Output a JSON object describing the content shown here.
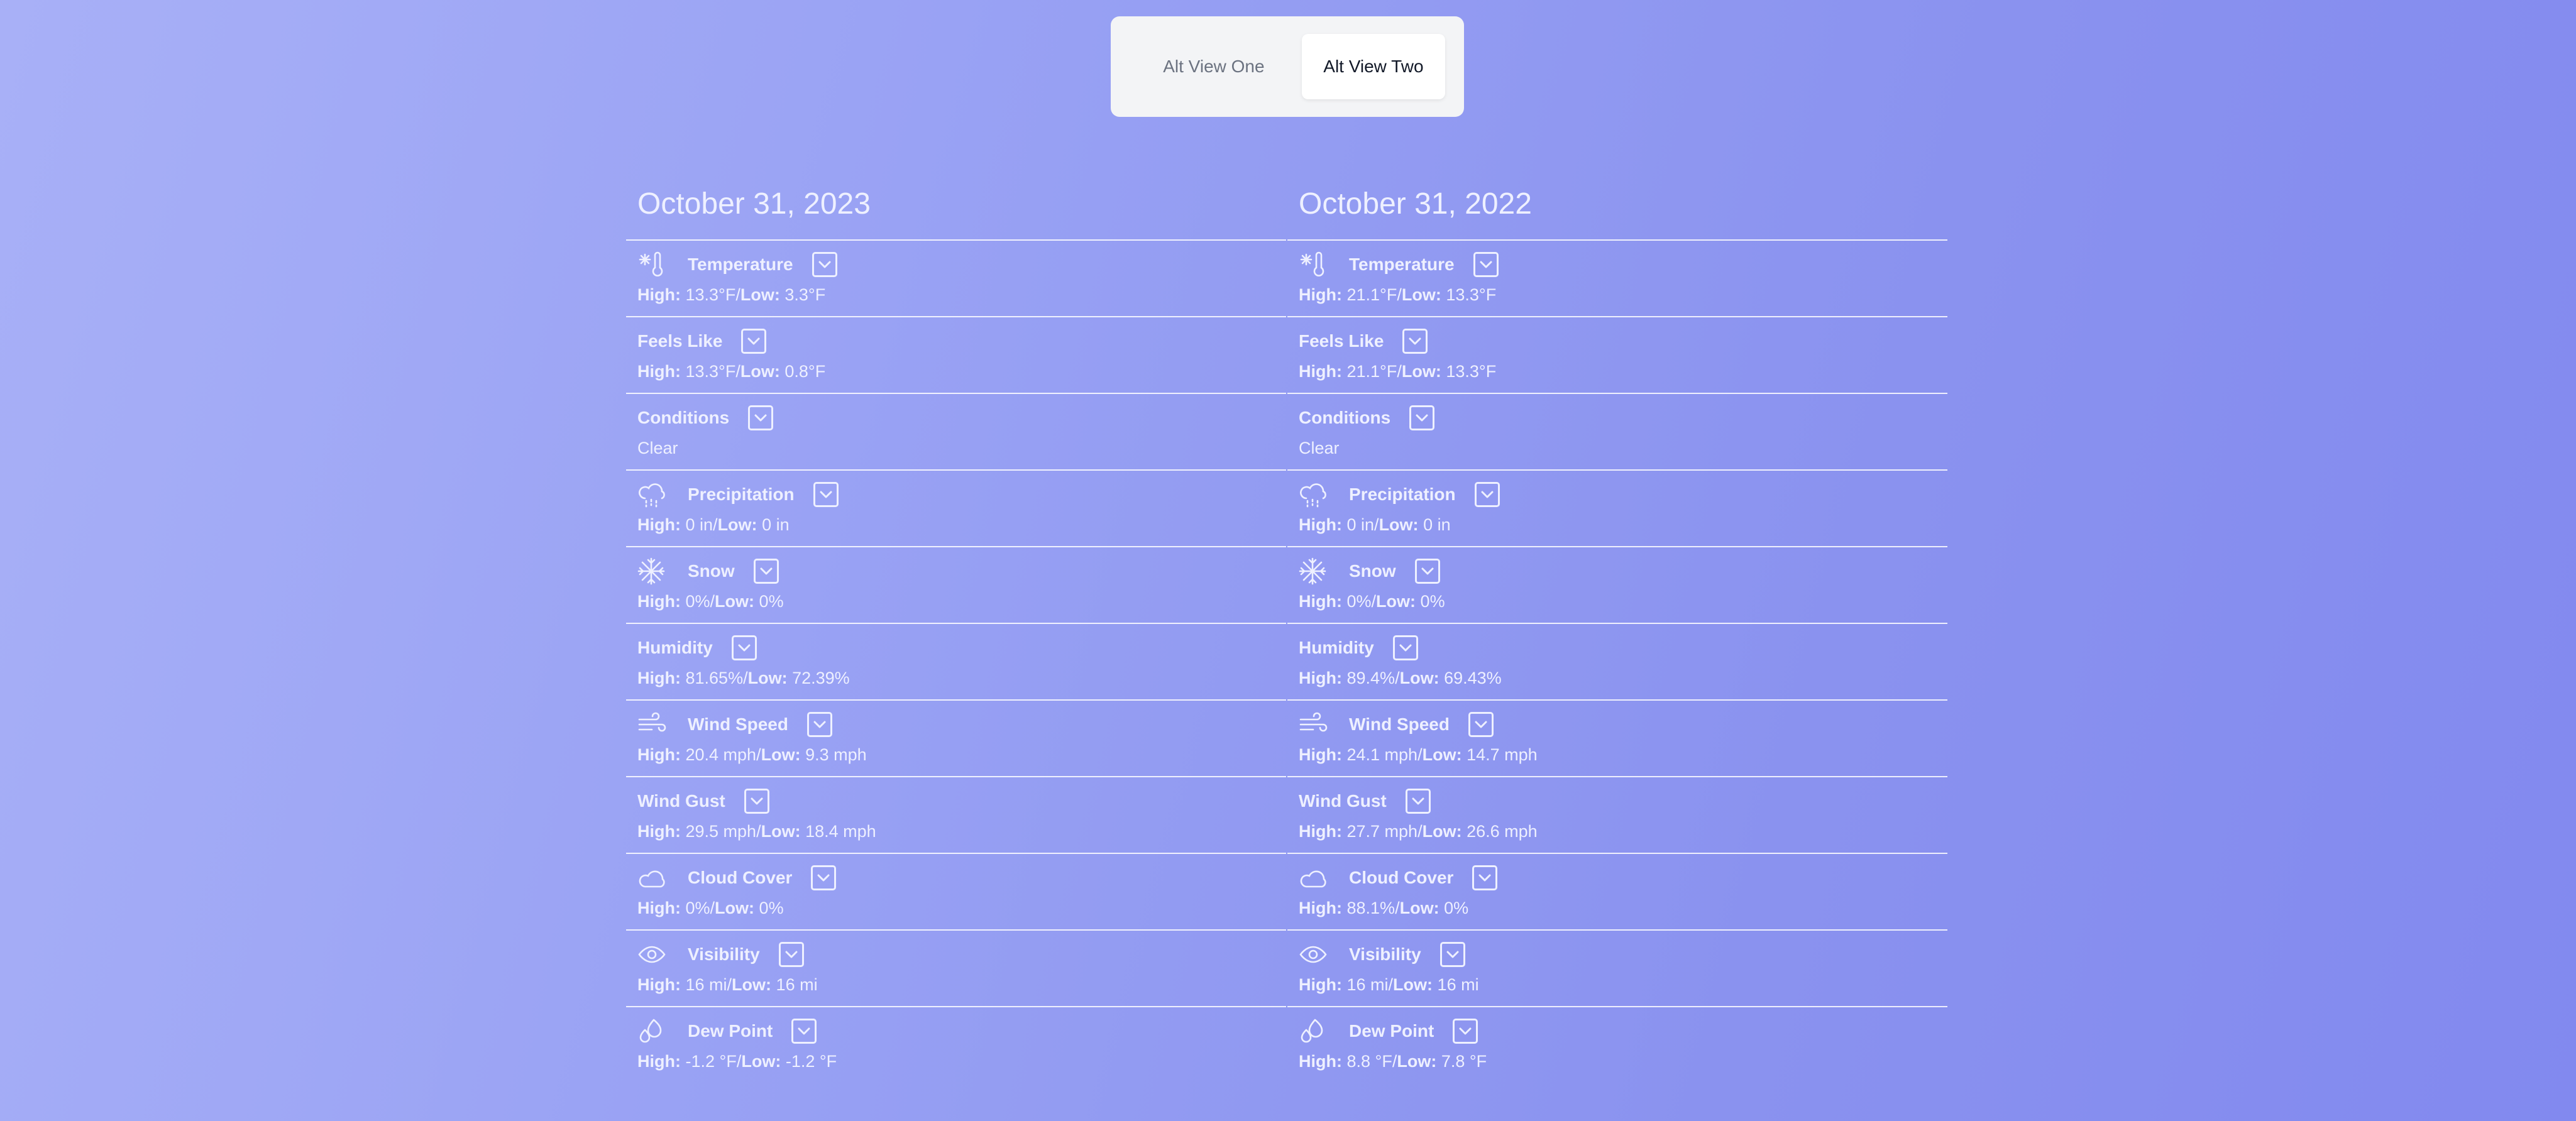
{
  "toggle": {
    "option_one": "Alt View One",
    "option_two": "Alt View Two",
    "selected": "Alt View Two"
  },
  "labels": {
    "high": "High:",
    "low": "Low:",
    "sep": "/"
  },
  "columns": [
    {
      "date": "October 31, 2023",
      "metrics": {
        "temperature": {
          "label": "Temperature",
          "icon": "thermometer-snow-icon",
          "high": "13.3°F",
          "low": "3.3°F"
        },
        "feels_like": {
          "label": "Feels Like",
          "high": "13.3°F",
          "low": "0.8°F"
        },
        "conditions": {
          "label": "Conditions",
          "value": "Clear"
        },
        "precipitation": {
          "label": "Precipitation",
          "icon": "cloud-drizzle-icon",
          "high": "0 in",
          "low": "0 in"
        },
        "snow": {
          "label": "Snow",
          "icon": "snowflake-icon",
          "high": "0%",
          "low": "0%"
        },
        "humidity": {
          "label": "Humidity",
          "high": "81.65%",
          "low": "72.39%"
        },
        "wind_speed": {
          "label": "Wind Speed",
          "icon": "wind-icon",
          "high": "20.4 mph",
          "low": "9.3 mph"
        },
        "wind_gust": {
          "label": "Wind Gust",
          "high": "29.5 mph",
          "low": "18.4 mph"
        },
        "cloud_cover": {
          "label": "Cloud Cover",
          "icon": "cloud-icon",
          "high": "0%",
          "low": "0%"
        },
        "visibility": {
          "label": "Visibility",
          "icon": "eye-icon",
          "high": "16 mi",
          "low": "16 mi"
        },
        "dew_point": {
          "label": "Dew Point",
          "icon": "droplets-icon",
          "high": "-1.2 °F",
          "low": "-1.2 °F"
        }
      }
    },
    {
      "date": "October 31, 2022",
      "metrics": {
        "temperature": {
          "label": "Temperature",
          "icon": "thermometer-snow-icon",
          "high": "21.1°F",
          "low": "13.3°F"
        },
        "feels_like": {
          "label": "Feels Like",
          "high": "21.1°F",
          "low": "13.3°F"
        },
        "conditions": {
          "label": "Conditions",
          "value": "Clear"
        },
        "precipitation": {
          "label": "Precipitation",
          "icon": "cloud-drizzle-icon",
          "high": "0 in",
          "low": "0 in"
        },
        "snow": {
          "label": "Snow",
          "icon": "snowflake-icon",
          "high": "0%",
          "low": "0%"
        },
        "humidity": {
          "label": "Humidity",
          "high": "89.4%",
          "low": "69.43%"
        },
        "wind_speed": {
          "label": "Wind Speed",
          "icon": "wind-icon",
          "high": "24.1 mph",
          "low": "14.7 mph"
        },
        "wind_gust": {
          "label": "Wind Gust",
          "high": "27.7 mph",
          "low": "26.6 mph"
        },
        "cloud_cover": {
          "label": "Cloud Cover",
          "icon": "cloud-icon",
          "high": "88.1%",
          "low": "0%"
        },
        "visibility": {
          "label": "Visibility",
          "icon": "eye-icon",
          "high": "16 mi",
          "low": "16 mi"
        },
        "dew_point": {
          "label": "Dew Point",
          "icon": "droplets-icon",
          "high": "8.8 °F",
          "low": "7.8 °F"
        }
      }
    }
  ]
}
